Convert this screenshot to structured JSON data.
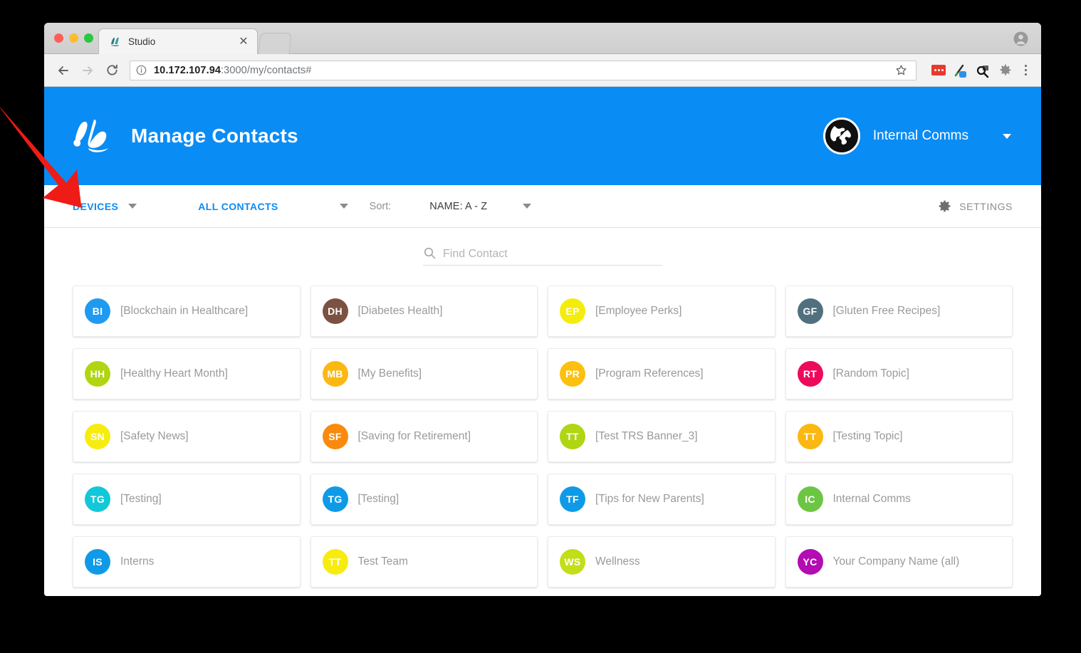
{
  "browser": {
    "tab": {
      "title": "Studio",
      "favicon_icon": "studio-favicon",
      "close_icon": "close-icon"
    },
    "traffic_lights": {
      "close": "close-window-button",
      "minimize": "minimize-window-button",
      "maximize": "maximize-window-button"
    },
    "toolbar": {
      "back_icon": "back-arrow-icon",
      "forward_icon": "forward-arrow-icon",
      "reload_icon": "reload-icon",
      "info_icon": "page-info-icon",
      "url_host": "10.172.107.94",
      "url_rest": ":3000/my/contacts#",
      "url_full": "10.172.107.94:3000/my/contacts#",
      "star_icon": "bookmark-star-icon",
      "extensions": [
        "adblock-extension-icon",
        "eyedropper-extension-icon",
        "inspect-extension-icon",
        "gear-extension-icon"
      ],
      "menu_icon": "browser-menu-icon",
      "profile_icon": "profile-avatar-icon"
    }
  },
  "app": {
    "header": {
      "logo_icon": "brush-b-logo",
      "title": "Manage Contacts",
      "org": {
        "avatar_icon": "globe-avatar-icon",
        "name": "Internal Comms",
        "caret_icon": "chevron-down-icon"
      }
    },
    "filterbar": {
      "devices": {
        "label": "DEVICES",
        "caret_icon": "chevron-down-icon"
      },
      "all_contacts": {
        "label": "ALL CONTACTS",
        "caret_icon": "chevron-down-icon"
      },
      "sort": {
        "label": "Sort:",
        "value": "NAME: A - Z",
        "caret_icon": "chevron-down-icon"
      },
      "settings": {
        "label": "SETTINGS",
        "icon": "gear-icon"
      }
    },
    "search": {
      "placeholder": "Find Contact",
      "value": "",
      "icon": "search-icon"
    },
    "contacts": [
      {
        "initials": "BI",
        "name": "[Blockchain in Healthcare]",
        "color": "#1e9bf0"
      },
      {
        "initials": "DH",
        "name": "[Diabetes Health]",
        "color": "#7b5242"
      },
      {
        "initials": "EP",
        "name": "[Employee Perks]",
        "color": "#f4ec0c"
      },
      {
        "initials": "GF",
        "name": "[Gluten Free Recipes]",
        "color": "#51707f"
      },
      {
        "initials": "HH",
        "name": "[Healthy Heart Month]",
        "color": "#b0d512"
      },
      {
        "initials": "MB",
        "name": "[My Benefits]",
        "color": "#fcb812"
      },
      {
        "initials": "PR",
        "name": "[Program References]",
        "color": "#fcc00e"
      },
      {
        "initials": "RT",
        "name": "[Random Topic]",
        "color": "#ee0a5b"
      },
      {
        "initials": "SN",
        "name": "[Safety News]",
        "color": "#f7ec10"
      },
      {
        "initials": "SF",
        "name": "[Saving for Retirement]",
        "color": "#f98a0d"
      },
      {
        "initials": "TT",
        "name": "[Test TRS Banner_3]",
        "color": "#b0d512"
      },
      {
        "initials": "TT",
        "name": "[Testing Topic]",
        "color": "#fcb812"
      },
      {
        "initials": "TG",
        "name": "[Testing]",
        "color": "#12c8d8"
      },
      {
        "initials": "TG",
        "name": "[Testing]",
        "color": "#0f9ae8"
      },
      {
        "initials": "TF",
        "name": "[Tips for New Parents]",
        "color": "#0f9ae8"
      },
      {
        "initials": "IC",
        "name": "Internal Comms",
        "color": "#6cc644"
      },
      {
        "initials": "IS",
        "name": "Interns",
        "color": "#0f9ae8"
      },
      {
        "initials": "TT",
        "name": "Test Team",
        "color": "#f7ec10"
      },
      {
        "initials": "WS",
        "name": "Wellness",
        "color": "#c2de18"
      },
      {
        "initials": "YC",
        "name": "Your Company Name (all)",
        "color": "#b20cb2"
      }
    ]
  },
  "annotation": {
    "arrow_icon": "red-pointer-arrow",
    "color": "#ee1b17"
  },
  "theme": {
    "brand_blue": "#0a8cf5",
    "link_blue": "#0a8cf5",
    "muted_gray": "#9a9a9a"
  }
}
